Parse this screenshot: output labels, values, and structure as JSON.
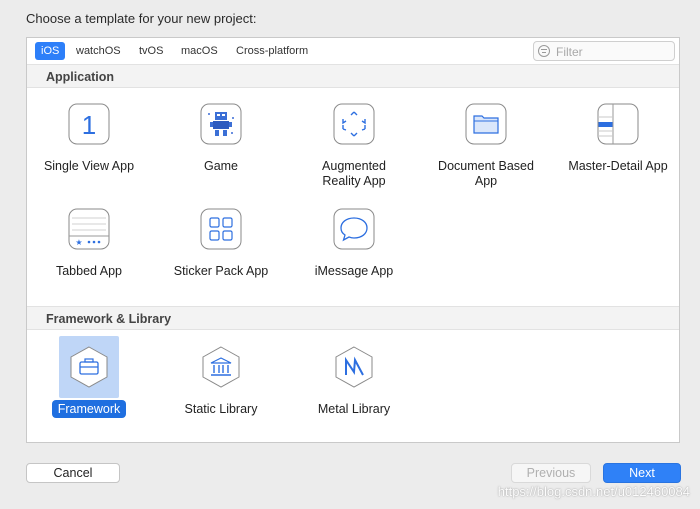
{
  "window": {
    "title": "Choose a template for your new project:"
  },
  "platform_tabs": [
    {
      "label": "iOS",
      "active": true
    },
    {
      "label": "watchOS",
      "active": false
    },
    {
      "label": "tvOS",
      "active": false
    },
    {
      "label": "macOS",
      "active": false
    },
    {
      "label": "Cross-platform",
      "active": false
    }
  ],
  "filter": {
    "placeholder": "Filter",
    "value": "",
    "icon": "filter-icon"
  },
  "sections": {
    "application": {
      "title": "Application",
      "items": [
        {
          "label": "Single View App",
          "icon": "single-view-app-icon"
        },
        {
          "label": "Game",
          "icon": "game-icon"
        },
        {
          "label": "Augmented Reality App",
          "icon": "augmented-reality-icon"
        },
        {
          "label": "Document Based App",
          "icon": "document-based-icon"
        },
        {
          "label": "Master-Detail App",
          "icon": "master-detail-icon"
        },
        {
          "label": "Tabbed App",
          "icon": "tabbed-app-icon"
        },
        {
          "label": "Sticker Pack App",
          "icon": "sticker-pack-icon"
        },
        {
          "label": "iMessage App",
          "icon": "imessage-icon"
        }
      ]
    },
    "framework": {
      "title": "Framework & Library",
      "items": [
        {
          "label": "Framework",
          "icon": "framework-icon",
          "selected": true
        },
        {
          "label": "Static Library",
          "icon": "static-library-icon",
          "selected": false
        },
        {
          "label": "Metal Library",
          "icon": "metal-library-icon",
          "selected": false
        }
      ]
    }
  },
  "buttons": {
    "cancel": "Cancel",
    "previous": "Previous",
    "next": "Next"
  },
  "watermark": "https://blog.csdn.net/u012460084",
  "colors": {
    "accent": "#2f81f7",
    "selection": "#bfd6f7",
    "icon_blue": "#2d6fe0"
  }
}
